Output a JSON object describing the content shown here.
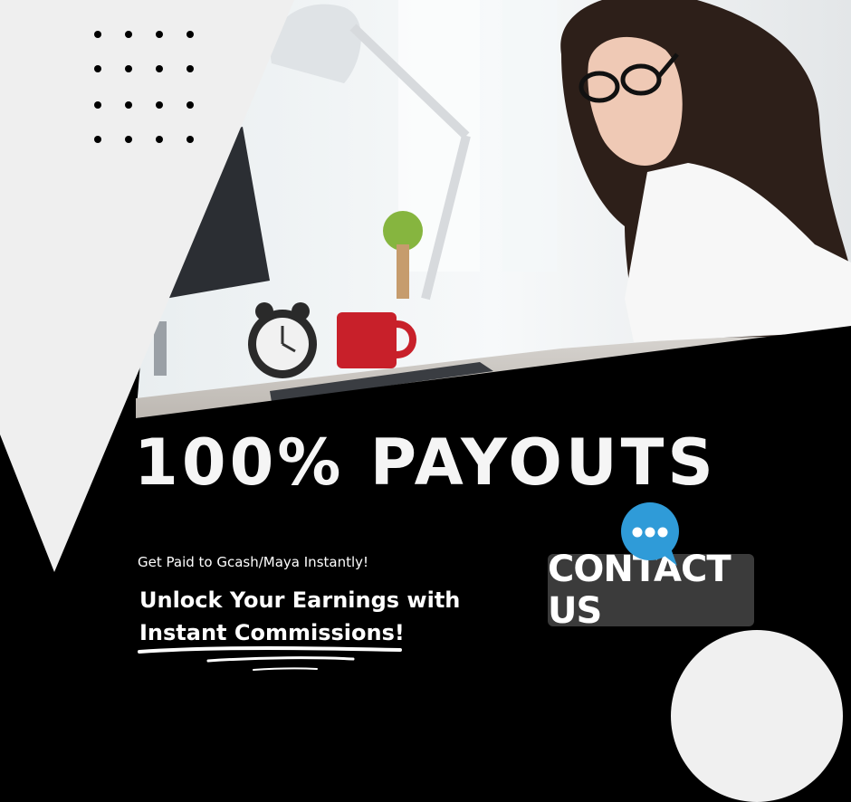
{
  "headline": "100% PAYOUTS",
  "subheading": "Get Paid to Gcash/Maya Instantly!",
  "tagline_line1": "Unlock Your Earnings with",
  "tagline_line2": "Instant Commissions!",
  "contact_button": "CONTACT US",
  "icons": {
    "chat": "chat-bubble-icon",
    "dots": "dot-grid-decoration"
  },
  "colors": {
    "background": "#000000",
    "light_panel": "#efefef",
    "accent_blue": "#2f9bd8",
    "button_bg": "#3b3b3b",
    "mug_red": "#c8202a"
  }
}
